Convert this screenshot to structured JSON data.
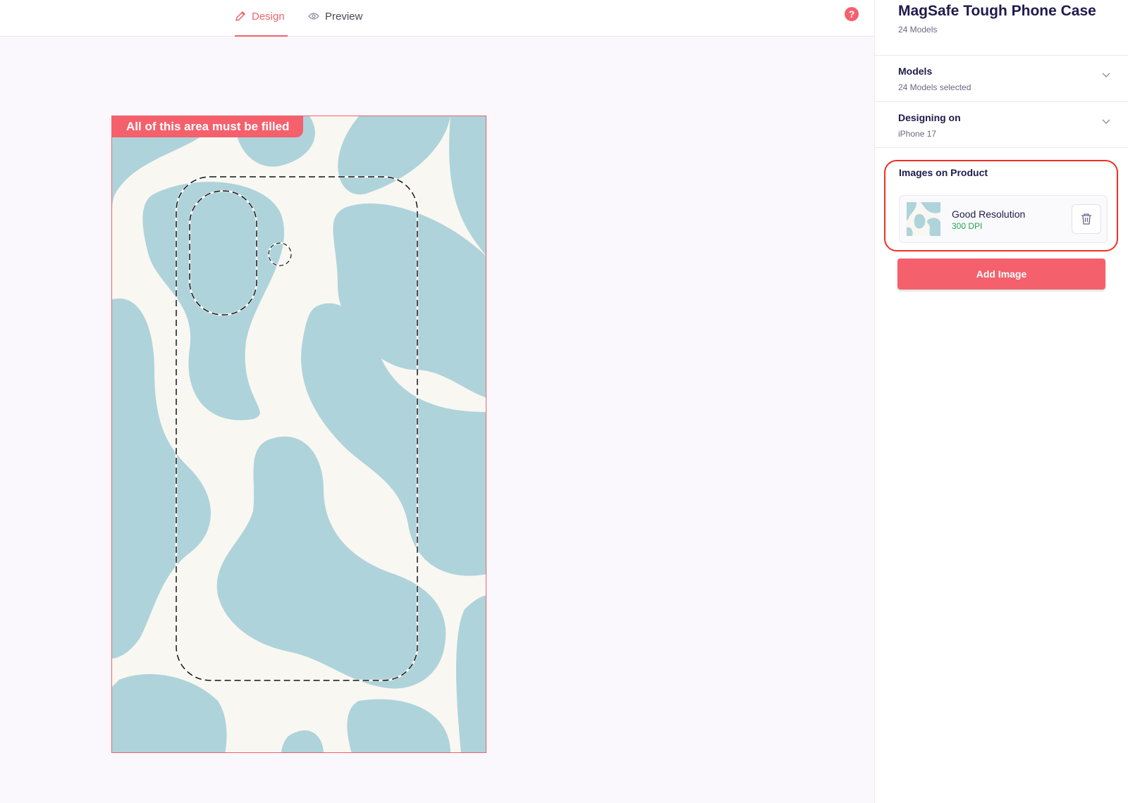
{
  "tabs": {
    "design": {
      "label": "Design",
      "icon": "pencil-icon",
      "active": true
    },
    "preview": {
      "label": "Preview",
      "icon": "eye-icon",
      "active": false
    }
  },
  "help": {
    "icon": "question-icon",
    "glyph": "?"
  },
  "canvas": {
    "banner": "All of this area must be filled",
    "pattern_colors": {
      "background": "#f9f7f1",
      "blob": "#aed3db"
    }
  },
  "panel": {
    "product_title": "MagSafe Tough Phone Case",
    "product_models": "24 Models",
    "models": {
      "title": "Models",
      "subtitle": "24 Models selected"
    },
    "designing_on": {
      "title": "Designing on",
      "subtitle": "iPhone 17"
    },
    "images": {
      "title": "Images on Product",
      "items": [
        {
          "name": "Good Resolution",
          "dpi": "300 DPI"
        }
      ]
    },
    "add_image_label": "Add Image"
  },
  "colors": {
    "accent": "#f4606c",
    "title_text": "#1f1b4d",
    "good_dpi": "#1faa59",
    "highlight_ring": "#ef2f22"
  }
}
